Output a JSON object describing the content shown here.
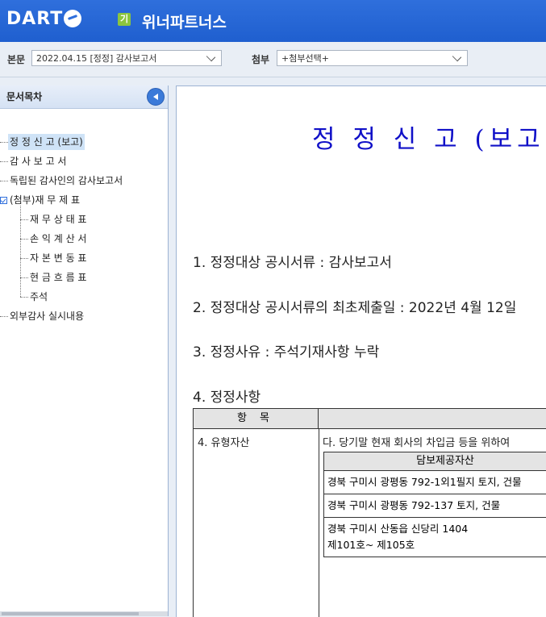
{
  "header": {
    "logo_text": "DART",
    "corp_badge": "기",
    "corp_name": "위너파트너스"
  },
  "selectors": {
    "main_label": "본문",
    "main_value": "2022.04.15  [정정] 감사보고서",
    "attach_label": "첨부",
    "attach_value": "+첨부선택+"
  },
  "sidebar": {
    "title": "문서목차",
    "items": [
      {
        "label": "정 정 신 고 (보고)"
      },
      {
        "label": "감 사 보 고 서"
      },
      {
        "label": "독립된 감사인의 감사보고서"
      },
      {
        "label": "(첨부)재 무 제 표"
      },
      {
        "label": "재 무 상 태 표"
      },
      {
        "label": "손 익 계 산 서"
      },
      {
        "label": "자 본 변 동 표"
      },
      {
        "label": "현 금 흐 름 표"
      },
      {
        "label": "주석"
      },
      {
        "label": "외부감사 실시내용"
      }
    ]
  },
  "document": {
    "title": "정 정 신 고 (보고)",
    "items": [
      "1. 정정대상 공시서류 : 감사보고서",
      "2. 정정대상 공시서류의 최초제출일 : 2022년 4월 12일",
      "3. 정정사유 : 주석기재사항 누락",
      "4. 정정사항"
    ],
    "table": {
      "header_item": "항 목",
      "row_item": "4. 유형자산",
      "row_desc": "다. 당기말 현재 회사의 차입금 등을 위하여",
      "inner_header": "담보제공자산",
      "inner_rows": [
        "경북 구미시 광평동 792-1외1필지 토지, 건물",
        "경북 구미시 광평동 792-137 토지, 건물",
        "경북 구미시 산동읍 신당리 1404",
        "제101호~ 제105호"
      ]
    }
  },
  "colors": {
    "header_blue": "#2f6fdc",
    "title_blue": "#1010c8",
    "badge_green": "#8bc53f"
  }
}
